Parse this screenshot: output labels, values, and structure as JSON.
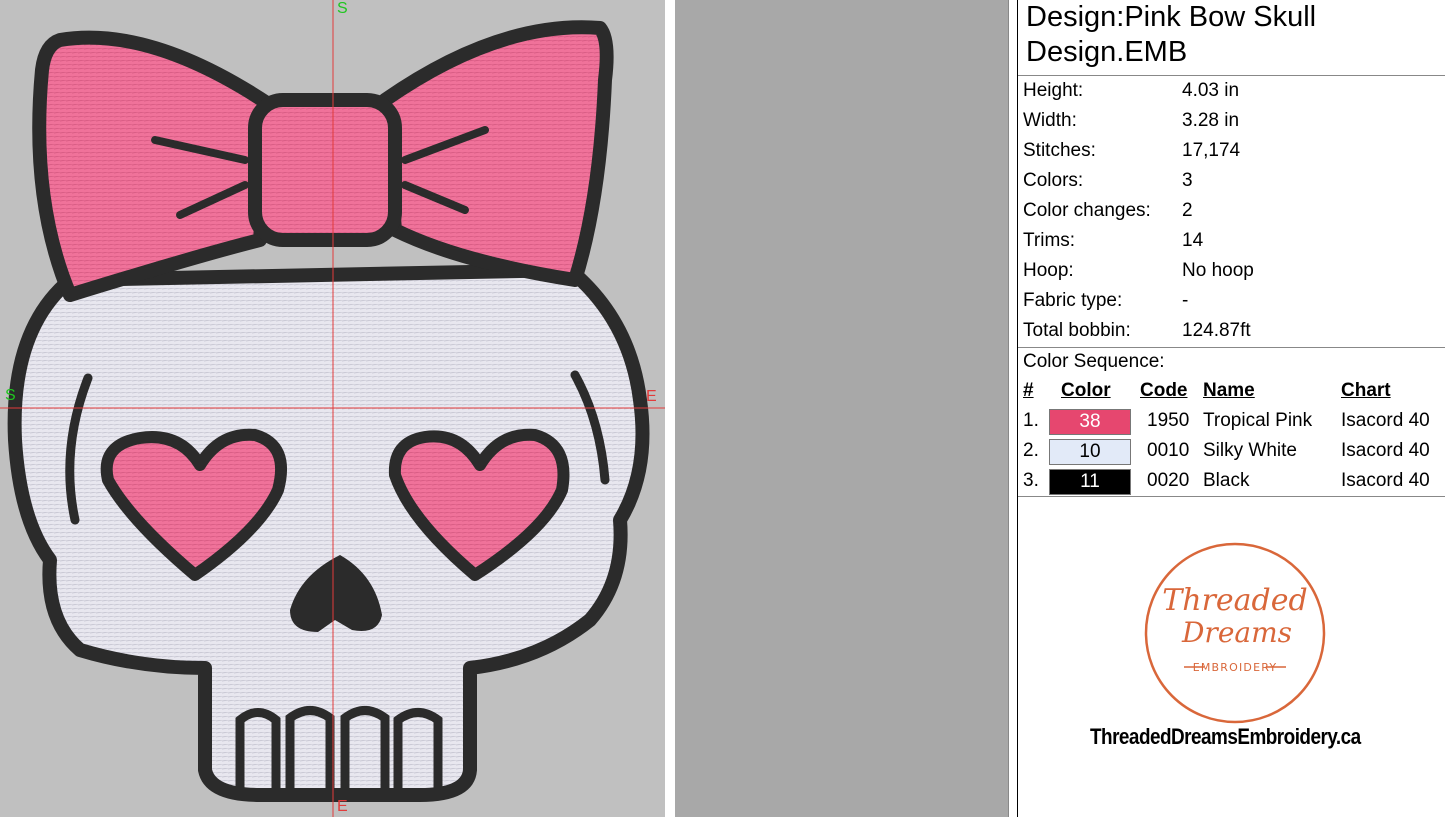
{
  "canvas": {
    "axis_markers": {
      "top": "S",
      "left": "S",
      "right": "E",
      "bottom": "E"
    }
  },
  "design": {
    "title": "Design:Pink Bow Skull",
    "file": "Design.EMB"
  },
  "properties": [
    {
      "label": "Height:",
      "value": "4.03 in"
    },
    {
      "label": "Width:",
      "value": "3.28 in"
    },
    {
      "label": "Stitches:",
      "value": "17,174"
    },
    {
      "label": "Colors:",
      "value": "3"
    },
    {
      "label": "Color changes:",
      "value": "2"
    },
    {
      "label": "Trims:",
      "value": "14"
    },
    {
      "label": "Hoop:",
      "value": "No hoop"
    },
    {
      "label": "Fabric type:",
      "value": "-"
    },
    {
      "label": "Total bobbin:",
      "value": "124.87ft"
    }
  ],
  "color_sequence": {
    "heading": "Color Sequence:",
    "columns": {
      "num": "#",
      "color": "Color",
      "code": "Code",
      "name": "Name",
      "chart": "Chart"
    },
    "rows": [
      {
        "num": "1.",
        "swatch_label": "38",
        "swatch_color": "#e6476f",
        "text_color": "#ffffff",
        "code": "1950",
        "name": "Tropical Pink",
        "chart": "Isacord 40"
      },
      {
        "num": "2.",
        "swatch_label": "10",
        "swatch_color": "#e2eaf8",
        "text_color": "#000000",
        "code": "0010",
        "name": "Silky White",
        "chart": "Isacord 40"
      },
      {
        "num": "3.",
        "swatch_label": "11",
        "swatch_color": "#000000",
        "text_color": "#ffffff",
        "code": "0020",
        "name": "Black",
        "chart": "Isacord 40"
      }
    ]
  },
  "logo": {
    "line1": "Threaded",
    "line2": "Dreams",
    "line3": "EMBROIDERY",
    "color": "#d9673a"
  },
  "website": "ThreadedDreamsEmbroidery.ca"
}
